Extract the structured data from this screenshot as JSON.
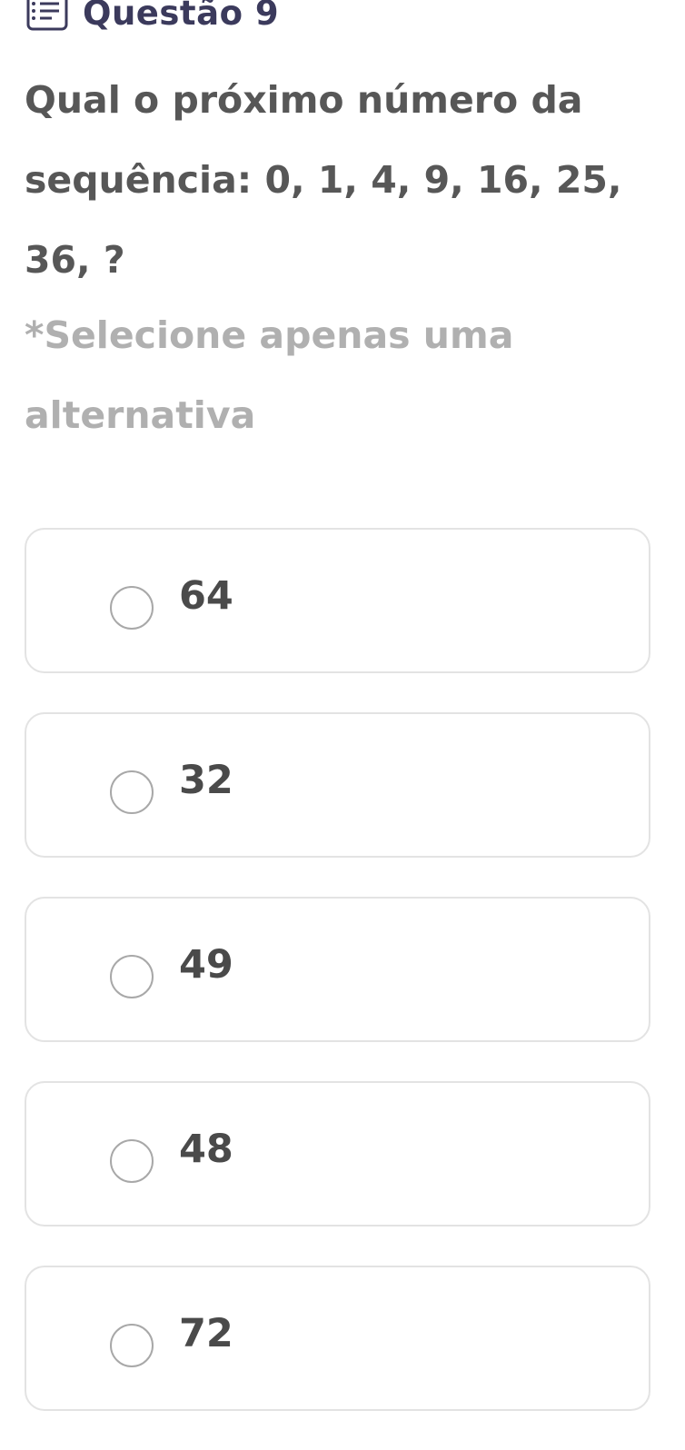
{
  "header": {
    "icon": "checklist-icon",
    "title": "Questão 9"
  },
  "question": {
    "text": "Qual o próximo número da sequência: 0, 1, 4, 9, 16, 25, 36, ?",
    "hint": "*Selecione apenas uma alternativa"
  },
  "options": [
    {
      "label": "64",
      "selected": false
    },
    {
      "label": "32",
      "selected": false
    },
    {
      "label": "49",
      "selected": false
    },
    {
      "label": "48",
      "selected": false
    },
    {
      "label": "72",
      "selected": false
    }
  ],
  "colors": {
    "title": "#3b3a5c",
    "question_text": "#575757",
    "hint_text": "#b0b0b0",
    "option_border": "#e3e3e3",
    "radio_border": "#a8a8a8"
  }
}
